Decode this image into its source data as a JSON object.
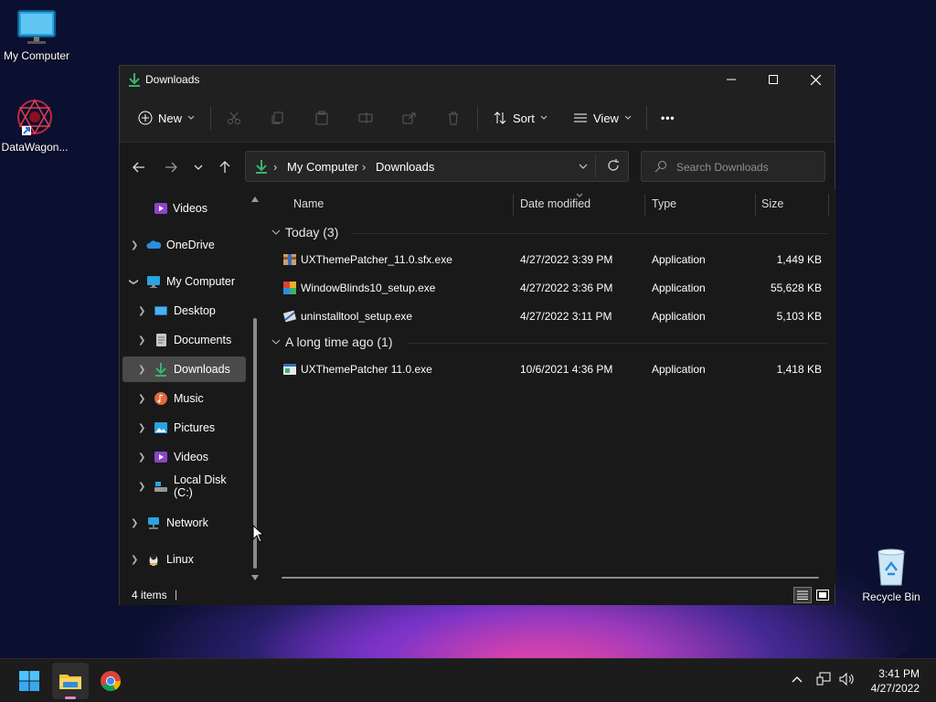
{
  "desktop": {
    "icons": [
      {
        "label": "My Computer"
      },
      {
        "label": "DataWagon..."
      },
      {
        "label": "Recycle Bin"
      }
    ]
  },
  "window": {
    "title": "Downloads",
    "controls": {
      "minimize": "—",
      "maximize": "☐",
      "close": "✕"
    }
  },
  "commandbar": {
    "new_label": "New",
    "sort_label": "Sort",
    "view_label": "View",
    "more_label": "•••"
  },
  "address": {
    "crumbs": [
      "My Computer",
      "Downloads"
    ],
    "separator": "›"
  },
  "search": {
    "placeholder": "Search Downloads"
  },
  "navpane": {
    "items": [
      {
        "label": "Videos",
        "icon": "videos-icon"
      },
      {
        "label": "OneDrive",
        "icon": "onedrive-icon"
      },
      {
        "label": "My Computer",
        "icon": "computer-icon"
      },
      {
        "label": "Desktop",
        "icon": "desktop-icon"
      },
      {
        "label": "Documents",
        "icon": "documents-icon"
      },
      {
        "label": "Downloads",
        "icon": "downloads-icon",
        "selected": true
      },
      {
        "label": "Music",
        "icon": "music-icon"
      },
      {
        "label": "Pictures",
        "icon": "pictures-icon"
      },
      {
        "label": "Videos",
        "icon": "videos-icon"
      },
      {
        "label": "Local Disk (C:)",
        "icon": "drive-icon"
      },
      {
        "label": "Network",
        "icon": "network-icon"
      },
      {
        "label": "Linux",
        "icon": "linux-icon"
      }
    ]
  },
  "columns": {
    "name": "Name",
    "date": "Date modified",
    "type": "Type",
    "size": "Size"
  },
  "groups": [
    {
      "label": "Today (3)",
      "files": [
        {
          "name": "UXThemePatcher_11.0.sfx.exe",
          "date": "4/27/2022 3:39 PM",
          "type": "Application",
          "size": "1,449 KB"
        },
        {
          "name": "WindowBlinds10_setup.exe",
          "date": "4/27/2022 3:36 PM",
          "type": "Application",
          "size": "55,628 KB"
        },
        {
          "name": "uninstalltool_setup.exe",
          "date": "4/27/2022 3:11 PM",
          "type": "Application",
          "size": "5,103 KB"
        }
      ]
    },
    {
      "label": "A long time ago (1)",
      "files": [
        {
          "name": "UXThemePatcher 11.0.exe",
          "date": "10/6/2021 4:36 PM",
          "type": "Application",
          "size": "1,418 KB"
        }
      ]
    }
  ],
  "statusbar": {
    "items_count": "4 items",
    "cursor": "|"
  },
  "taskbar": {
    "clock_time": "3:41 PM",
    "clock_date": "4/27/2022"
  },
  "colors": {
    "accent": "#4cc2ff",
    "download_green": "#3bb26a",
    "window_bg": "#191919",
    "selected_bg": "#4a4a4a"
  }
}
